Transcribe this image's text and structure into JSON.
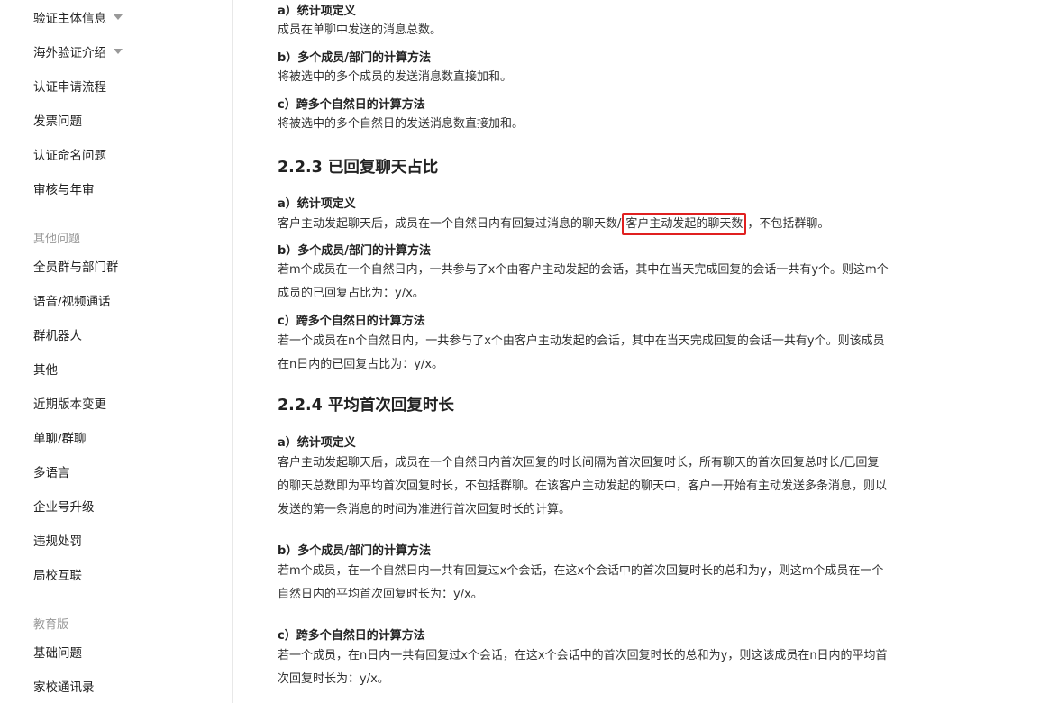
{
  "sidebar": {
    "items_top": [
      {
        "label": "验证主体信息"
      },
      {
        "label": "海外验证介绍"
      },
      {
        "label": "认证申请流程"
      },
      {
        "label": "发票问题"
      },
      {
        "label": "认证命名问题"
      },
      {
        "label": "审核与年审"
      }
    ],
    "section_other": "其他问题",
    "items_other": [
      {
        "label": "全员群与部门群"
      },
      {
        "label": "语音/视频通话"
      },
      {
        "label": "群机器人"
      },
      {
        "label": "其他"
      },
      {
        "label": "近期版本变更"
      },
      {
        "label": "单聊/群聊"
      },
      {
        "label": "多语言"
      },
      {
        "label": "企业号升级"
      },
      {
        "label": "违规处罚"
      },
      {
        "label": "局校互联"
      }
    ],
    "section_edu": "教育版",
    "items_edu": [
      {
        "label": "基础问题"
      },
      {
        "label": "家校通讯录"
      }
    ]
  },
  "content": {
    "s0": {
      "a_title": "a）统计项定义",
      "a_text": "成员在单聊中发送的消息总数。",
      "b_title": "b）多个成员/部门的计算方法",
      "b_text": "将被选中的多个成员的发送消息数直接加和。",
      "c_title": "c）跨多个自然日的计算方法",
      "c_text": "将被选中的多个自然日的发送消息数直接加和。"
    },
    "s223": {
      "heading": "2.2.3 已回复聊天占比",
      "a_title": "a）统计项定义",
      "a_text_pre": "客户主动发起聊天后，成员在一个自然日内有回复过消息的聊天数/",
      "a_text_hl": "客户主动发起的聊天数",
      "a_text_post": "，不包括群聊。",
      "b_title": "b）多个成员/部门的计算方法",
      "b_text_1": "若m个成员在一个自然日内，一共参与了x个由客户主动发起的会话，其中在当天完成回复的会话一共有y个。则这m个",
      "b_text_2": "成员的已回复占比为：y/x。",
      "c_title": "c）跨多个自然日的计算方法",
      "c_text_1": "若一个成员在n个自然日内，一共参与了x个由客户主动发起的会话，其中在当天完成回复的会话一共有y个。则该成员",
      "c_text_2": "在n日内的已回复占比为：y/x。"
    },
    "s224": {
      "heading": "2.2.4 平均首次回复时长",
      "a_title": "a）统计项定义",
      "a_text_1": "客户主动发起聊天后，成员在一个自然日内首次回复的时长间隔为首次回复时长，所有聊天的首次回复总时长/已回复",
      "a_text_2": "的聊天总数即为平均首次回复时长，不包括群聊。在该客户主动发起的聊天中，客户一开始有主动发送多条消息，则以",
      "a_text_3": "发送的第一条消息的时间为准进行首次回复时长的计算。",
      "b_title": "b）多个成员/部门的计算方法",
      "b_text_1": "若m个成员，在一个自然日内一共有回复过x个会话，在这x个会话中的首次回复时长的总和为y，则这m个成员在一个",
      "b_text_2": "自然日内的平均首次回复时长为：y/x。",
      "c_title": "c）跨多个自然日的计算方法",
      "c_text_1": "若一个成员，在n日内一共有回复过x个会话，在这x个会话中的首次回复时长的总和为y，则这该成员在n日内的平均首",
      "c_text_2": "次回复时长为：y/x。"
    }
  },
  "colors": {
    "highlight_border": "#e02020",
    "section_label": "#999999",
    "divider": "#e8e8e8"
  },
  "icons": {
    "expand_caret": "caret-down-icon"
  }
}
